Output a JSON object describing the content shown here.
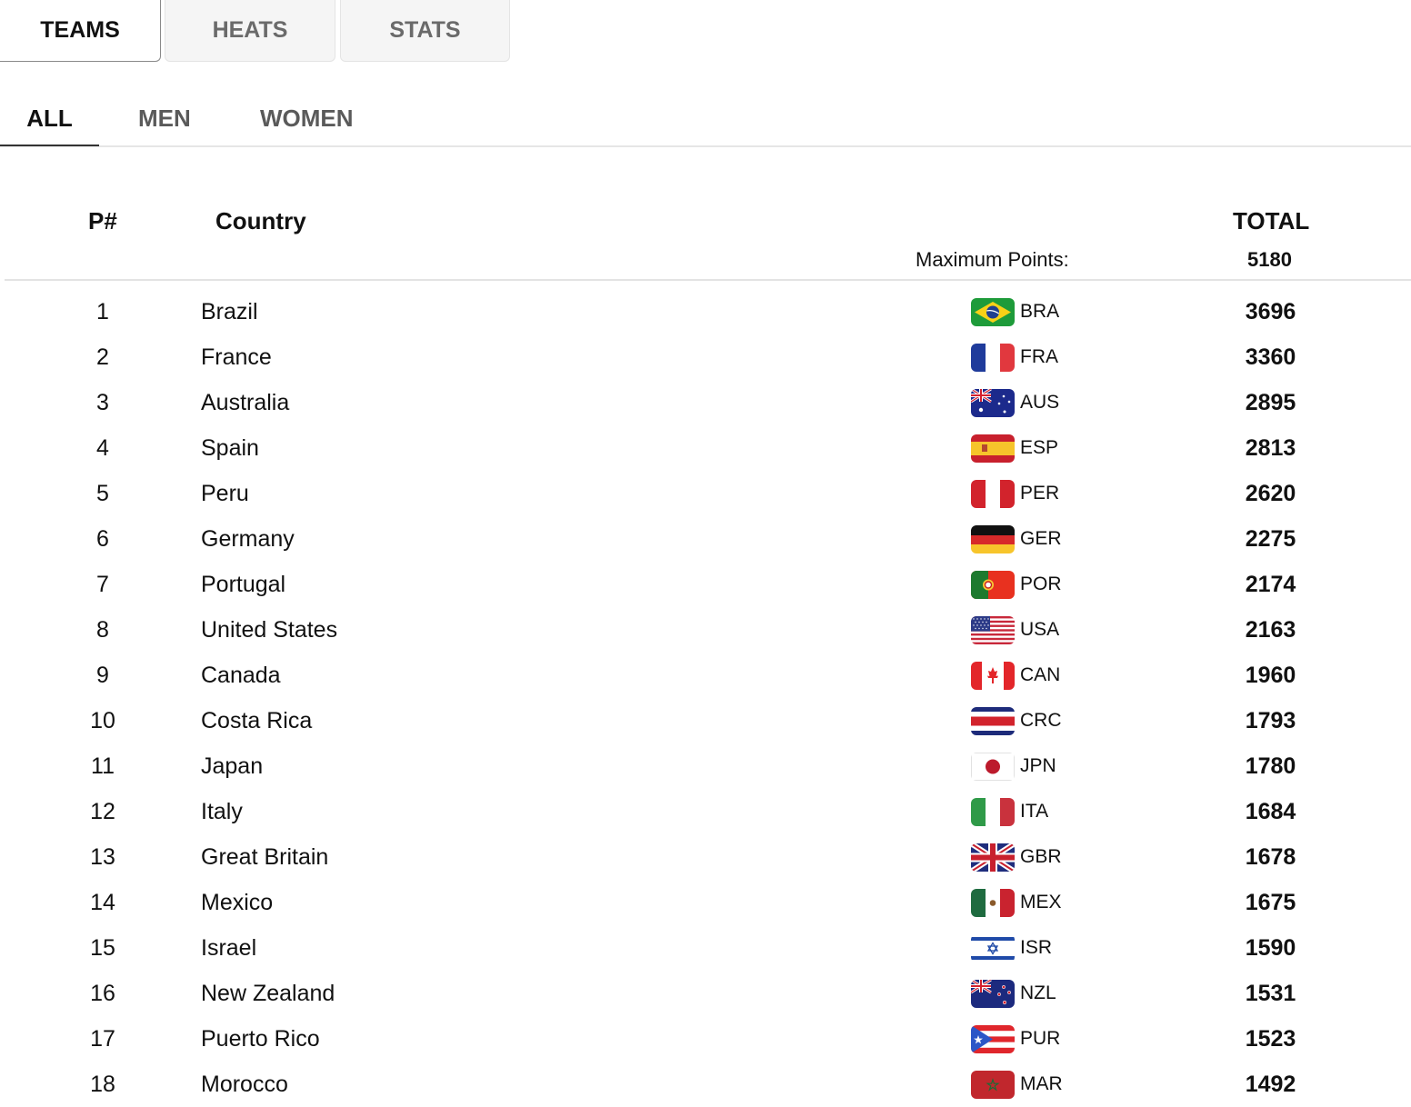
{
  "top_tabs": {
    "teams": "TEAMS",
    "heats": "HEATS",
    "stats": "STATS"
  },
  "sub_tabs": {
    "all": "ALL",
    "men": "MEN",
    "women": "WOMEN"
  },
  "table": {
    "header": {
      "position": "P#",
      "country": "Country",
      "total": "TOTAL",
      "max_points_label": "Maximum Points:",
      "max_points_value": "5180"
    },
    "rows": [
      {
        "pos": "1",
        "country": "Brazil",
        "code": "BRA",
        "total": "3696",
        "flag": "brazil-flag-icon"
      },
      {
        "pos": "2",
        "country": "France",
        "code": "FRA",
        "total": "3360",
        "flag": "france-flag-icon"
      },
      {
        "pos": "3",
        "country": "Australia",
        "code": "AUS",
        "total": "2895",
        "flag": "australia-flag-icon"
      },
      {
        "pos": "4",
        "country": "Spain",
        "code": "ESP",
        "total": "2813",
        "flag": "spain-flag-icon"
      },
      {
        "pos": "5",
        "country": "Peru",
        "code": "PER",
        "total": "2620",
        "flag": "peru-flag-icon"
      },
      {
        "pos": "6",
        "country": "Germany",
        "code": "GER",
        "total": "2275",
        "flag": "germany-flag-icon"
      },
      {
        "pos": "7",
        "country": "Portugal",
        "code": "POR",
        "total": "2174",
        "flag": "portugal-flag-icon"
      },
      {
        "pos": "8",
        "country": "United States",
        "code": "USA",
        "total": "2163",
        "flag": "usa-flag-icon"
      },
      {
        "pos": "9",
        "country": "Canada",
        "code": "CAN",
        "total": "1960",
        "flag": "canada-flag-icon"
      },
      {
        "pos": "10",
        "country": "Costa Rica",
        "code": "CRC",
        "total": "1793",
        "flag": "costa-rica-flag-icon"
      },
      {
        "pos": "11",
        "country": "Japan",
        "code": "JPN",
        "total": "1780",
        "flag": "japan-flag-icon"
      },
      {
        "pos": "12",
        "country": "Italy",
        "code": "ITA",
        "total": "1684",
        "flag": "italy-flag-icon"
      },
      {
        "pos": "13",
        "country": "Great Britain",
        "code": "GBR",
        "total": "1678",
        "flag": "great-britain-flag-icon"
      },
      {
        "pos": "14",
        "country": "Mexico",
        "code": "MEX",
        "total": "1675",
        "flag": "mexico-flag-icon"
      },
      {
        "pos": "15",
        "country": "Israel",
        "code": "ISR",
        "total": "1590",
        "flag": "israel-flag-icon"
      },
      {
        "pos": "16",
        "country": "New Zealand",
        "code": "NZL",
        "total": "1531",
        "flag": "new-zealand-flag-icon"
      },
      {
        "pos": "17",
        "country": "Puerto Rico",
        "code": "PUR",
        "total": "1523",
        "flag": "puerto-rico-flag-icon"
      },
      {
        "pos": "18",
        "country": "Morocco",
        "code": "MAR",
        "total": "1492",
        "flag": "morocco-flag-icon"
      }
    ]
  }
}
